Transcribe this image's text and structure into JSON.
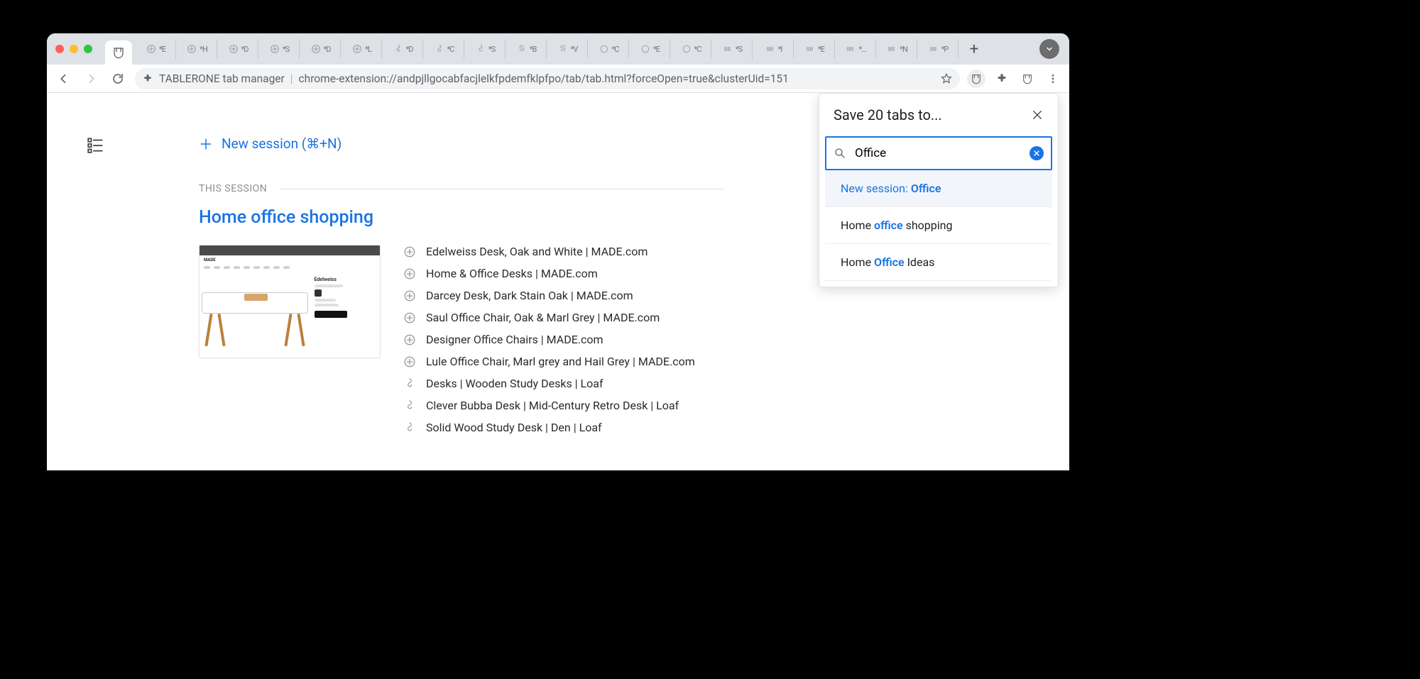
{
  "chrome": {
    "extension_name": "TABLERONE tab manager",
    "url": "chrome-extension://andpjllgocabfacjlelkfpdemfklpfpo/tab/tab.html?forceOpen=true&clusterUid=151",
    "mini_tabs": [
      {
        "icon": "oplus",
        "suffix": "*E"
      },
      {
        "icon": "oplus",
        "suffix": "*H"
      },
      {
        "icon": "oplus",
        "suffix": "*D"
      },
      {
        "icon": "oplus",
        "suffix": "*S"
      },
      {
        "icon": "oplus",
        "suffix": "*D"
      },
      {
        "icon": "oplus",
        "suffix": "*L"
      },
      {
        "icon": "loop",
        "suffix": "*D"
      },
      {
        "icon": "loop",
        "suffix": "*C"
      },
      {
        "icon": "loop",
        "suffix": "*S"
      },
      {
        "icon": "ess",
        "suffix": "*B"
      },
      {
        "icon": "ess",
        "suffix": "*V"
      },
      {
        "icon": "circle",
        "suffix": "*C"
      },
      {
        "icon": "circle",
        "suffix": "*E"
      },
      {
        "icon": "circle",
        "suffix": "*C"
      },
      {
        "icon": "bars",
        "suffix": "*S"
      },
      {
        "icon": "bars",
        "suffix": "*I"
      },
      {
        "icon": "bars",
        "suffix": "*E"
      },
      {
        "icon": "bars",
        "suffix": "*…"
      },
      {
        "icon": "bars",
        "suffix": "*N"
      },
      {
        "icon": "bars",
        "suffix": "*P"
      }
    ]
  },
  "main": {
    "new_session_label": "New session (⌘+N)",
    "section_label": "THIS SESSION",
    "session_title": "Home office shopping",
    "preview": {
      "brand": "MADE",
      "product": "Edelweiss"
    },
    "items": [
      {
        "fav": "oplus",
        "title": "Edelweiss Desk, Oak and White | MADE.com"
      },
      {
        "fav": "oplus",
        "title": "Home & Office Desks | MADE.com"
      },
      {
        "fav": "oplus",
        "title": "Darcey Desk, Dark Stain Oak | MADE.com"
      },
      {
        "fav": "oplus",
        "title": "Saul Office Chair, Oak & Marl Grey | MADE.com"
      },
      {
        "fav": "oplus",
        "title": "Designer Office Chairs | MADE.com"
      },
      {
        "fav": "oplus",
        "title": "Lule Office Chair, Marl grey and Hail Grey | MADE.com"
      },
      {
        "fav": "loop",
        "title": "Desks | Wooden Study Desks | Loaf"
      },
      {
        "fav": "loop",
        "title": "Clever Bubba Desk | Mid-Century Retro Desk | Loaf"
      },
      {
        "fav": "loop",
        "title": "Solid Wood Study Desk | Den | Loaf"
      }
    ]
  },
  "popup": {
    "title_prefix": "Save ",
    "count": "20",
    "title_suffix": " tabs to...",
    "search_value": "Office",
    "new_session_prefix": "New session: ",
    "new_session_name": "Office",
    "suggestions": [
      {
        "pre": "Home ",
        "match": "office",
        "post": " shopping"
      },
      {
        "pre": "Home ",
        "match": "Office",
        "post": " Ideas"
      }
    ]
  }
}
